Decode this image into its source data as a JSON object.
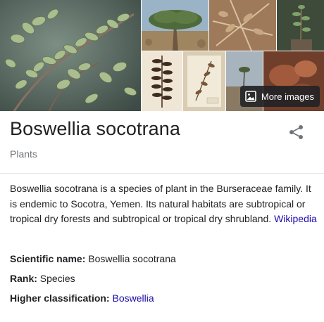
{
  "gallery": {
    "more_images_label": "More images",
    "more_images_icon": "image-icon"
  },
  "entity": {
    "title": "Boswellia socotrana",
    "category": "Plants",
    "share_icon": "share-icon"
  },
  "description": {
    "text": "Boswellia socotrana is a species of plant in the Burseraceae family. It is endemic to Socotra, Yemen. Its natural habitats are subtropical or tropical dry forests and subtropical or tropical dry shrubland.",
    "source_link": "Wikipedia"
  },
  "facts": [
    {
      "label": "Scientific name:",
      "value": "Boswellia socotrana"
    },
    {
      "label": "Rank:",
      "value": "Species"
    },
    {
      "label": "Higher classification:",
      "value": "Boswellia",
      "is_link": true
    }
  ],
  "colors": {
    "link": "#1a0dab",
    "secondary_text": "#70757a",
    "primary_text": "#202124"
  }
}
